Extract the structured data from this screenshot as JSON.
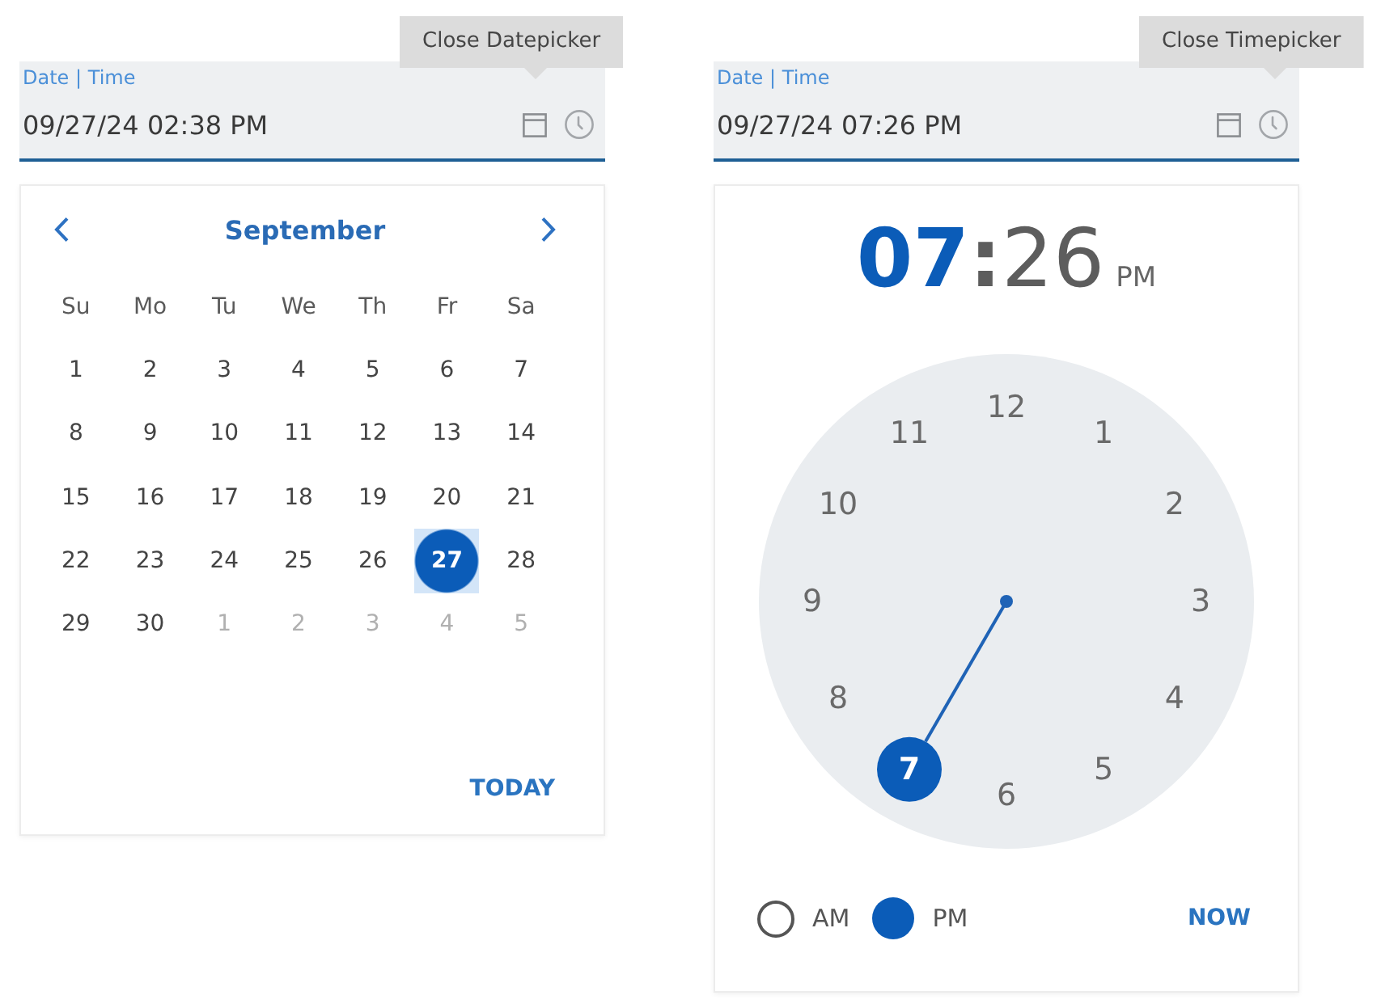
{
  "date_picker": {
    "field": {
      "label": "Date | Time",
      "value": "09/27/24 02:38 PM",
      "icons": [
        {
          "kind": "calendar"
        },
        {
          "kind": "clock"
        }
      ]
    },
    "tooltip": "Close Datepicker",
    "calendar": {
      "month": "September",
      "weekdays": [
        "Su",
        "Mo",
        "Tu",
        "We",
        "Th",
        "Fr",
        "Sa"
      ],
      "weeks": [
        [
          {
            "day": "1",
            "other_month": false,
            "selected": false
          },
          {
            "day": "2",
            "other_month": false,
            "selected": false
          },
          {
            "day": "3",
            "other_month": false,
            "selected": false
          },
          {
            "day": "4",
            "other_month": false,
            "selected": false
          },
          {
            "day": "5",
            "other_month": false,
            "selected": false
          },
          {
            "day": "6",
            "other_month": false,
            "selected": false
          },
          {
            "day": "7",
            "other_month": false,
            "selected": false
          }
        ],
        [
          {
            "day": "8",
            "other_month": false,
            "selected": false
          },
          {
            "day": "9",
            "other_month": false,
            "selected": false
          },
          {
            "day": "10",
            "other_month": false,
            "selected": false
          },
          {
            "day": "11",
            "other_month": false,
            "selected": false
          },
          {
            "day": "12",
            "other_month": false,
            "selected": false
          },
          {
            "day": "13",
            "other_month": false,
            "selected": false
          },
          {
            "day": "14",
            "other_month": false,
            "selected": false
          }
        ],
        [
          {
            "day": "15",
            "other_month": false,
            "selected": false
          },
          {
            "day": "16",
            "other_month": false,
            "selected": false
          },
          {
            "day": "17",
            "other_month": false,
            "selected": false
          },
          {
            "day": "18",
            "other_month": false,
            "selected": false
          },
          {
            "day": "19",
            "other_month": false,
            "selected": false
          },
          {
            "day": "20",
            "other_month": false,
            "selected": false
          },
          {
            "day": "21",
            "other_month": false,
            "selected": false
          }
        ],
        [
          {
            "day": "22",
            "other_month": false,
            "selected": false
          },
          {
            "day": "23",
            "other_month": false,
            "selected": false
          },
          {
            "day": "24",
            "other_month": false,
            "selected": false
          },
          {
            "day": "25",
            "other_month": false,
            "selected": false
          },
          {
            "day": "26",
            "other_month": false,
            "selected": false
          },
          {
            "day": "27",
            "other_month": false,
            "selected": true
          },
          {
            "day": "28",
            "other_month": false,
            "selected": false
          }
        ],
        [
          {
            "day": "29",
            "other_month": false,
            "selected": false
          },
          {
            "day": "30",
            "other_month": false,
            "selected": false
          },
          {
            "day": "1",
            "other_month": true,
            "selected": false
          },
          {
            "day": "2",
            "other_month": true,
            "selected": false
          },
          {
            "day": "3",
            "other_month": true,
            "selected": false
          },
          {
            "day": "4",
            "other_month": true,
            "selected": false
          },
          {
            "day": "5",
            "other_month": true,
            "selected": false
          }
        ]
      ],
      "today_button": "TODAY"
    }
  },
  "time_picker": {
    "field": {
      "label": "Date | Time",
      "value": "09/27/24 07:26 PM",
      "icons": [
        {
          "kind": "calendar"
        },
        {
          "kind": "clock"
        }
      ]
    },
    "tooltip": "Close Timepicker",
    "clock": {
      "hours": {
        "text": "07",
        "selected": true
      },
      "separator": ":",
      "minutes": {
        "text": "26",
        "selected": false
      },
      "period": "PM",
      "dial": [
        {
          "label": "12",
          "selected": false
        },
        {
          "label": "1",
          "selected": false
        },
        {
          "label": "2",
          "selected": false
        },
        {
          "label": "3",
          "selected": false
        },
        {
          "label": "4",
          "selected": false
        },
        {
          "label": "5",
          "selected": false
        },
        {
          "label": "6",
          "selected": false
        },
        {
          "label": "7",
          "selected": true
        },
        {
          "label": "8",
          "selected": false
        },
        {
          "label": "9",
          "selected": false
        },
        {
          "label": "10",
          "selected": false
        },
        {
          "label": "11",
          "selected": false
        }
      ],
      "periods": [
        {
          "label": "AM",
          "selected": false
        },
        {
          "label": "PM",
          "selected": true
        }
      ],
      "now_button": "NOW"
    }
  }
}
